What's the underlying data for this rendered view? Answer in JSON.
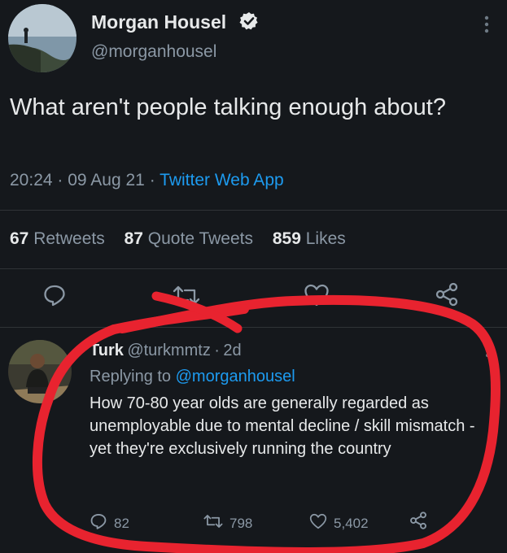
{
  "tweet": {
    "author_name": "Morgan Housel",
    "author_handle": "@morganhousel",
    "verified_icon": "verified-badge-icon",
    "text": "What aren't people talking enough about?",
    "time": "20:24",
    "date": "09 Aug 21",
    "source": "Twitter Web App",
    "separator": "·",
    "stats": {
      "retweets_count": "67",
      "retweets_label": "Retweets",
      "quotes_count": "87",
      "quotes_label": "Quote Tweets",
      "likes_count": "859",
      "likes_label": "Likes"
    },
    "actions": [
      "reply-icon",
      "retweet-icon",
      "like-icon",
      "share-icon"
    ]
  },
  "reply": {
    "author_name": "Turk",
    "author_handle": "@turkmmtz",
    "age": "2d",
    "separator": "·",
    "replying_prefix": "Replying to",
    "replying_to": "@morganhousel",
    "text": "How 70-80 year olds are generally regarded as unemployable due to mental decline / skill mismatch - yet they're exclusively running the country",
    "replies": "82",
    "retweets": "798",
    "likes": "5,402"
  },
  "colors": {
    "background": "#15181c",
    "accent": "#1d9bf0",
    "muted": "#8b98a5",
    "annotation": "#e8232f"
  }
}
